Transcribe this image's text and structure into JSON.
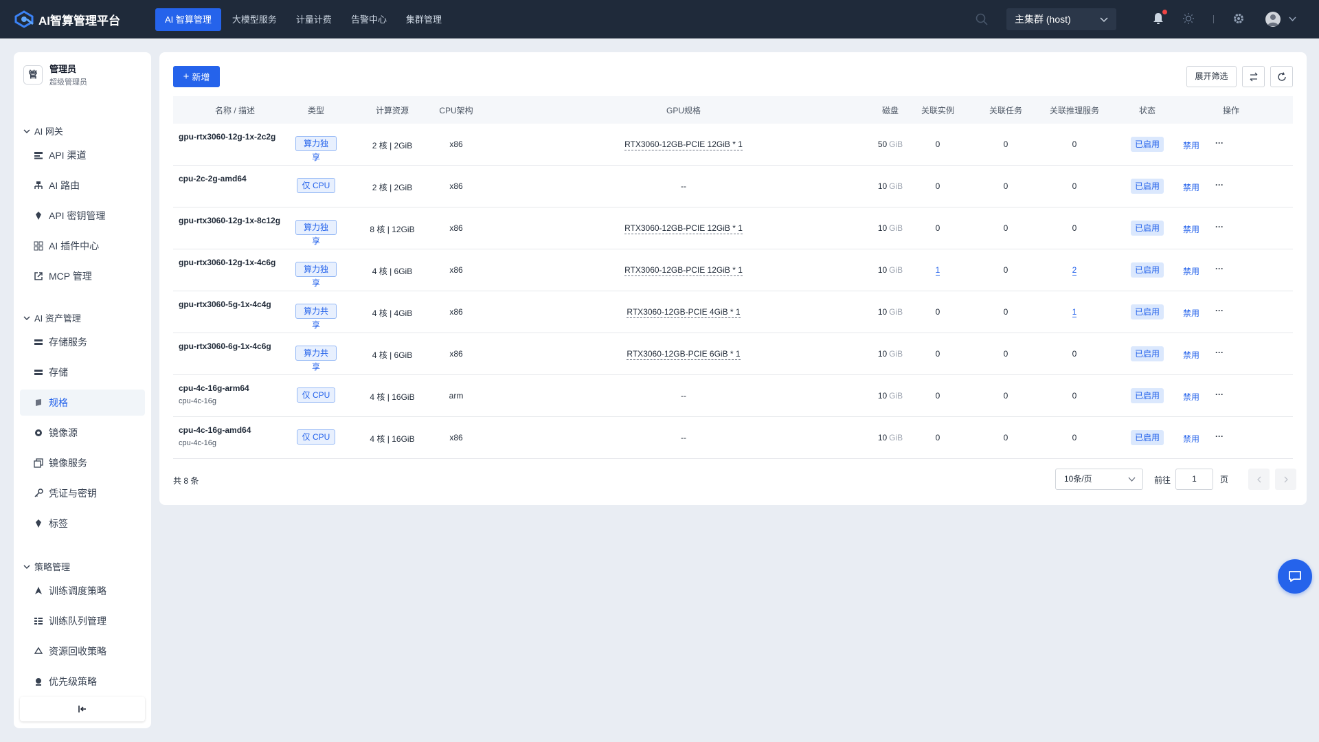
{
  "app": {
    "title": "AI智算管理平台"
  },
  "topnav": [
    {
      "label": "AI 智算管理",
      "active": true
    },
    {
      "label": "大模型服务",
      "active": false
    },
    {
      "label": "计量计费",
      "active": false
    },
    {
      "label": "告警中心",
      "active": false
    },
    {
      "label": "集群管理",
      "active": false
    }
  ],
  "cluster": {
    "selected": "主集群 (host)"
  },
  "user": {
    "badge": "管",
    "name": "管理员",
    "role": "超级管理员"
  },
  "sidebar": {
    "groups": [
      {
        "title": "AI 网关",
        "items": [
          {
            "label": "API 渠道",
            "icon": "api-channel-icon"
          },
          {
            "label": "AI 路由",
            "icon": "route-icon"
          },
          {
            "label": "API 密钥管理",
            "icon": "key-icon"
          },
          {
            "label": "AI 插件中心",
            "icon": "plugin-grid-icon"
          },
          {
            "label": "MCP 管理",
            "icon": "external-link-icon"
          }
        ]
      },
      {
        "title": "AI 资产管理",
        "items": [
          {
            "label": "存储服务",
            "icon": "storage-service-icon"
          },
          {
            "label": "存储",
            "icon": "storage-icon"
          },
          {
            "label": "规格",
            "icon": "spec-icon",
            "active": true
          },
          {
            "label": "镜像源",
            "icon": "image-source-icon"
          },
          {
            "label": "镜像服务",
            "icon": "image-service-icon"
          },
          {
            "label": "凭证与密钥",
            "icon": "credential-key-icon"
          },
          {
            "label": "标签",
            "icon": "tag-icon"
          }
        ]
      },
      {
        "title": "策略管理",
        "items": [
          {
            "label": "训练调度策略",
            "icon": "schedule-icon"
          },
          {
            "label": "训练队列管理",
            "icon": "queue-icon"
          },
          {
            "label": "资源回收策略",
            "icon": "recycle-icon"
          },
          {
            "label": "优先级策略",
            "icon": "priority-icon"
          }
        ]
      }
    ]
  },
  "toolbar": {
    "add_label": "新增",
    "filter_label": "展开筛选"
  },
  "table": {
    "headers": {
      "name": "名称 / 描述",
      "type": "类型",
      "compute": "计算资源",
      "cpu_arch": "CPU架构",
      "gpu": "GPU规格",
      "disk": "磁盘",
      "instances": "关联实例",
      "tasks": "关联任务",
      "inference": "关联推理服务",
      "status": "状态",
      "ops": "操作"
    },
    "rows": [
      {
        "name": "gpu-rtx3060-12g-1x-2c2g",
        "desc": "",
        "type": "算力独享",
        "compute": "2 核 | 2GiB",
        "cpu_arch": "x86",
        "gpu": "RTX3060-12GB-PCIE 12GiB * 1",
        "disk_value": "50",
        "disk_unit": "GiB",
        "instances": "0",
        "tasks": "0",
        "inference": "0",
        "status": "已启用",
        "op": "禁用",
        "more": "···"
      },
      {
        "name": "cpu-2c-2g-amd64",
        "desc": "",
        "type": "仅 CPU",
        "compute": "2 核 | 2GiB",
        "cpu_arch": "x86",
        "gpu": "--",
        "disk_value": "10",
        "disk_unit": "GiB",
        "instances": "0",
        "tasks": "0",
        "inference": "0",
        "status": "已启用",
        "op": "禁用",
        "more": "···"
      },
      {
        "name": "gpu-rtx3060-12g-1x-8c12g",
        "desc": "",
        "type": "算力独享",
        "compute": "8 核 | 12GiB",
        "cpu_arch": "x86",
        "gpu": "RTX3060-12GB-PCIE 12GiB * 1",
        "disk_value": "10",
        "disk_unit": "GiB",
        "instances": "0",
        "tasks": "0",
        "inference": "0",
        "status": "已启用",
        "op": "禁用",
        "more": "···"
      },
      {
        "name": "gpu-rtx3060-12g-1x-4c6g",
        "desc": "",
        "type": "算力独享",
        "compute": "4 核 | 6GiB",
        "cpu_arch": "x86",
        "gpu": "RTX3060-12GB-PCIE 12GiB * 1",
        "disk_value": "10",
        "disk_unit": "GiB",
        "instances": "1",
        "tasks": "0",
        "inference": "2",
        "status": "已启用",
        "op": "禁用",
        "more": "···"
      },
      {
        "name": "gpu-rtx3060-5g-1x-4c4g",
        "desc": "",
        "type": "算力共享",
        "compute": "4 核 | 4GiB",
        "cpu_arch": "x86",
        "gpu": "RTX3060-12GB-PCIE 4GiB * 1",
        "disk_value": "10",
        "disk_unit": "GiB",
        "instances": "0",
        "tasks": "0",
        "inference": "1",
        "status": "已启用",
        "op": "禁用",
        "more": "···"
      },
      {
        "name": "gpu-rtx3060-6g-1x-4c6g",
        "desc": "",
        "type": "算力共享",
        "compute": "4 核 | 6GiB",
        "cpu_arch": "x86",
        "gpu": "RTX3060-12GB-PCIE 6GiB * 1",
        "disk_value": "10",
        "disk_unit": "GiB",
        "instances": "0",
        "tasks": "0",
        "inference": "0",
        "status": "已启用",
        "op": "禁用",
        "more": "···"
      },
      {
        "name": "cpu-4c-16g-arm64",
        "desc": "cpu-4c-16g",
        "type": "仅 CPU",
        "compute": "4 核 | 16GiB",
        "cpu_arch": "arm",
        "gpu": "--",
        "disk_value": "10",
        "disk_unit": "GiB",
        "instances": "0",
        "tasks": "0",
        "inference": "0",
        "status": "已启用",
        "op": "禁用",
        "more": "···"
      },
      {
        "name": "cpu-4c-16g-amd64",
        "desc": "cpu-4c-16g",
        "type": "仅 CPU",
        "compute": "4 核 | 16GiB",
        "cpu_arch": "x86",
        "gpu": "--",
        "disk_value": "10",
        "disk_unit": "GiB",
        "instances": "0",
        "tasks": "0",
        "inference": "0",
        "status": "已启用",
        "op": "禁用",
        "more": "···"
      }
    ]
  },
  "pagination": {
    "total_text": "共 8 条",
    "page_size": "10条/页",
    "goto_label": "前往",
    "current_page": "1",
    "page_suffix": "页"
  },
  "colors": {
    "accent": "#2563eb",
    "topbar": "#1f2a3a",
    "background": "#e9edf3"
  }
}
